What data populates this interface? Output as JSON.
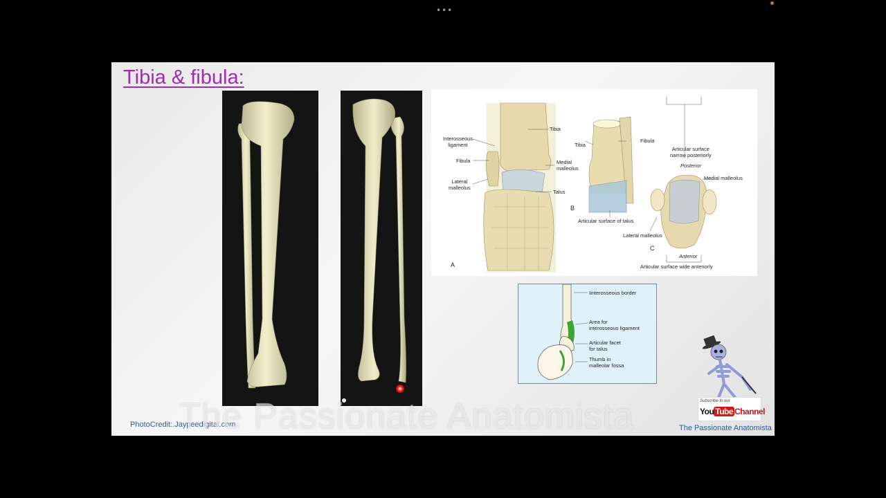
{
  "top_bar": {
    "dots": "•••"
  },
  "slide": {
    "title": "Tibia & fibula:",
    "photo_credit": "PhotoCredit:.Jaypeedigital.com",
    "watermark": "The Passionate Anatomista",
    "channel_name": "The Passionate Anatomista"
  },
  "diagram_a": {
    "labels": {
      "tibia_a": "Tibia",
      "interosseous": "Interosseous\nligament",
      "fibula_a": "Fibula",
      "lateral_malleolus_a": "Lateral\nmalleolus",
      "medial_malleolus_a": "Medial\nmalleolus",
      "talus": "Talus",
      "panel_a": "A",
      "tibia_b": "Tibia",
      "fibula_b": "Fibula",
      "panel_b": "B",
      "articular_talus": "Articular surface of talus",
      "articular_narrow": "Articular surface\nnarrow posteriorly",
      "posterior": "Posterior",
      "medial_malleolus_c": "Medial malleolus",
      "lateral_malleolus_c": "Lateral malleolus",
      "panel_c": "C",
      "anterior": "Anterior",
      "articular_wide": "Articular surface wide anteriorly"
    }
  },
  "diagram_b": {
    "labels": {
      "interosseous_border": "Iinterosseous border",
      "area_ligament": "Area for\ninterosseous ligament",
      "articular_facet": "Articular facet\nfor talus",
      "thumb": "Thumb in\nmalleolar fossa"
    }
  },
  "subscribe": {
    "small_text": "Subscribe to our",
    "you": "You",
    "tube": "Tube",
    "channel": "Channel"
  }
}
